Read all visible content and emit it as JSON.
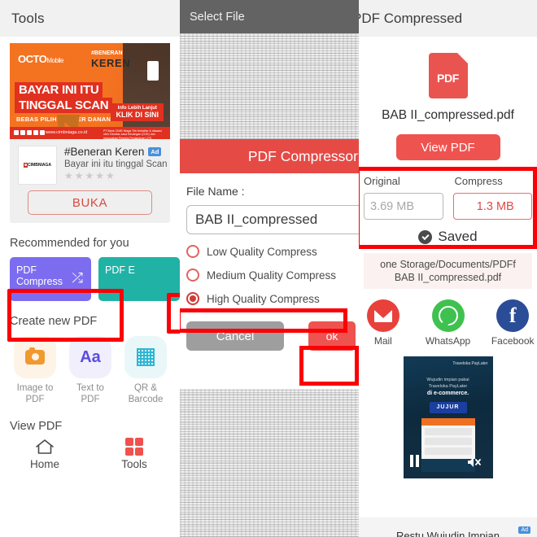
{
  "panel_left": {
    "header_title": "Tools",
    "ad": {
      "brand": "OCTO",
      "brand_sub": "Mobile",
      "tag_small": "#BENERAN",
      "tag_big": "KEREN",
      "headline_line1": "BAYAR INI ITU",
      "headline_line2": "TINGGAL SCAN",
      "subline": "BEBAS PILIH SUMBER DANANYA!",
      "cta_small": "Info Lebih Lanjut",
      "cta_big": "KLIK DI SINI",
      "footer_url": "www.cimbniaga.co.id",
      "footer_disclaimer": "PT Bank CIMB Niaga Tbk terdaftar & diawasi oleh Otoritas Jasa Keuangan (OJK) dan merupakan Peserta Penjaminan LPS",
      "advertiser": "CIMBNIAGA",
      "app_title": "#Beneran Keren",
      "badge": "Ad",
      "app_sub": "Bayar ini itu tinggal Scan",
      "stars": "★★★★★",
      "install_label": "BUKA"
    },
    "recommended_title": "Recommended for you",
    "recommended_tiles": [
      {
        "label_line1": "PDF",
        "label_line2": "Compress",
        "color": "#7c6cf0",
        "icon": "compress-arrows-icon"
      },
      {
        "label_line1": "PDF E",
        "label_line2": "",
        "color": "#21b2a6",
        "icon": "edit-icon"
      }
    ],
    "create_title": "Create new PDF",
    "create_tiles": [
      {
        "label_line1": "Image to",
        "label_line2": "PDF",
        "icon": "camera-icon"
      },
      {
        "label_line1": "Text to",
        "label_line2": "PDF",
        "icon": "text-aa-icon"
      },
      {
        "label_line1": "QR &",
        "label_line2": "Barcode",
        "icon": "qr-code-icon"
      }
    ],
    "view_title": "View PDF",
    "nav": [
      {
        "label": "Home",
        "icon": "home-icon"
      },
      {
        "label": "Tools",
        "icon": "grid-tools-icon"
      }
    ]
  },
  "panel_mid": {
    "header_title": "Select File",
    "dialog_title": "PDF Compressor",
    "file_name_label": "File Name :",
    "file_name_value": "BAB II_compressed",
    "options": [
      {
        "label": "Low Quality Compress",
        "selected": false
      },
      {
        "label": "Medium Quality Compress",
        "selected": false
      },
      {
        "label": "High Quality Compress",
        "selected": true
      }
    ],
    "cancel_label": "Cancel",
    "ok_label": "ok"
  },
  "panel_right": {
    "header_title": "PDF Compressed",
    "pdf_badge": "PDF",
    "file_name": "BAB II_compressed.pdf",
    "view_button": "View PDF",
    "original_label": "Original",
    "original_value": "3.69 MB",
    "compressed_label": "Compress",
    "compressed_value": "1.3 MB",
    "saved_label": "Saved",
    "path_line1": "one Storage/Documents/PDFf",
    "path_line2": "BAB II_compressed.pdf",
    "share": [
      {
        "label": "Mail",
        "icon": "mail-icon",
        "color": "#e8413c"
      },
      {
        "label": "WhatsApp",
        "icon": "whatsapp-icon",
        "color": "#3fc14f"
      },
      {
        "label": "Facebook",
        "icon": "facebook-icon",
        "color": "#2b4c96"
      }
    ],
    "video_ad": {
      "brand": "Traveloka PayLater",
      "line1": "Wujudin impian pakai",
      "line2": "Traveloka PayLater",
      "line3": "di e-commerce.",
      "badge": "JUJUR",
      "pause_icon": "pause-icon",
      "mute_icon": "mute-icon"
    },
    "bottom_text": "Restu Wujudin Impian",
    "bottom_badge": "Ad"
  },
  "colors": {
    "accent_red": "#ef5350",
    "highlight_red": "#fb0005",
    "purple_tile": "#7c6cf0",
    "teal_tile": "#21b2a6",
    "header_gray": "#f1f1f1",
    "dialog_header_gray": "#636363"
  }
}
